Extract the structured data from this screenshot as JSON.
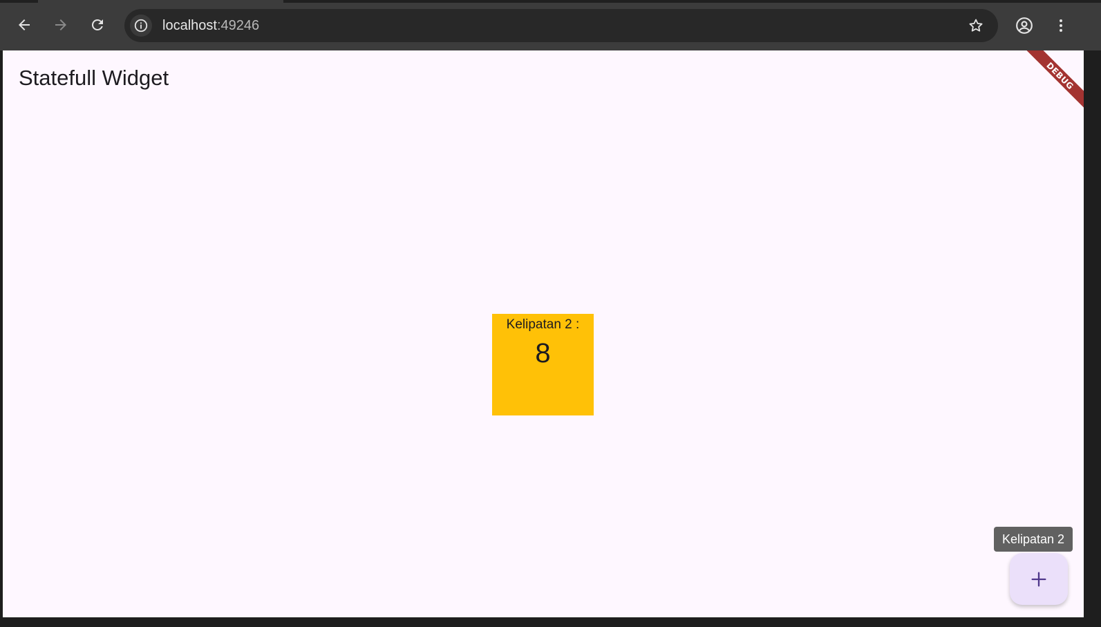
{
  "browser": {
    "url_host": "localhost",
    "url_port": ":49246",
    "icons": {
      "back": "arrow-left-icon",
      "forward": "arrow-right-icon",
      "reload": "reload-icon",
      "site_info": "info-icon",
      "bookmark": "star-icon",
      "profile": "account-circle-icon",
      "menu": "more-vert-icon"
    }
  },
  "app": {
    "title": "Statefull Widget",
    "counter_label": "Kelipatan 2 :",
    "counter_value": "8",
    "debug_banner": "DEBUG",
    "fab_tooltip": "Kelipatan 2",
    "fab_icon": "add-icon"
  },
  "colors": {
    "app_background": "#fef7ff",
    "counter_box": "#ffc107",
    "fab_background": "#ebe0fa",
    "fab_icon": "#4f378b",
    "debug_banner": "#a33331",
    "tooltip_background": "#616161"
  }
}
